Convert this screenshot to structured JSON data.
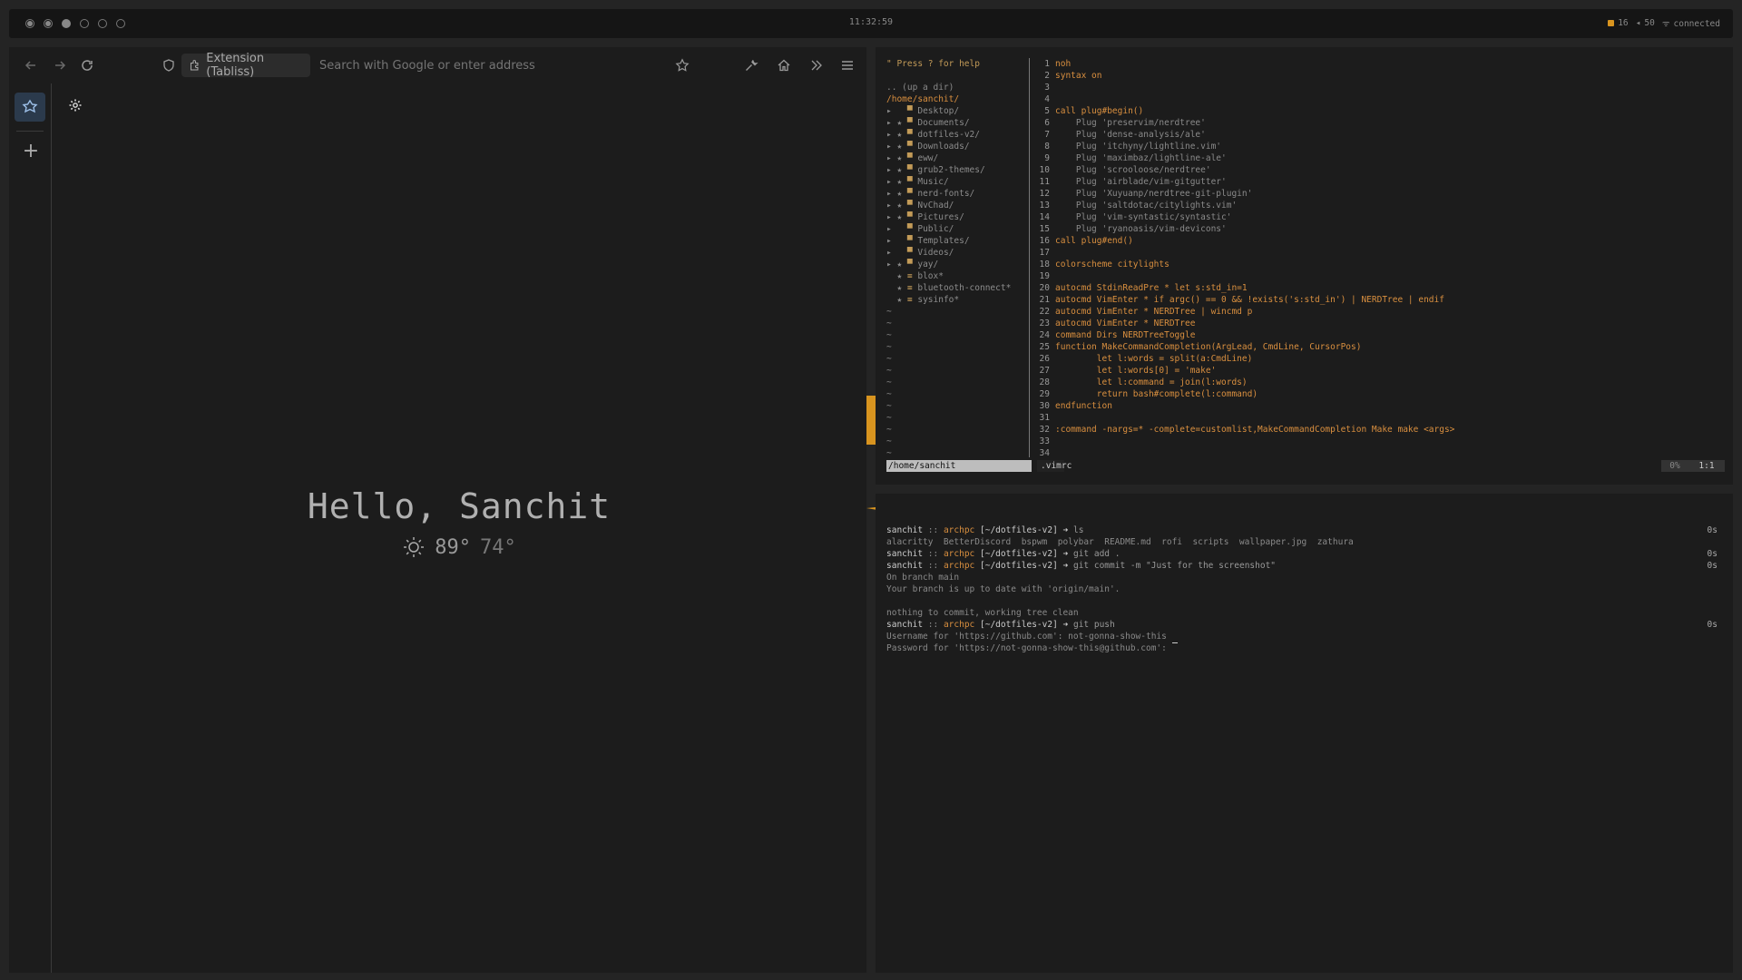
{
  "topbar": {
    "workspaces": [
      "1",
      "2",
      "3",
      "4",
      "5",
      "6"
    ],
    "clock": "11:32:59",
    "updates": "16",
    "volume": "50",
    "network": "connected"
  },
  "browser": {
    "url_pill": "Extension (Tabliss)",
    "url_placeholder": "Search with Google or enter address",
    "greeting": "Hello, Sanchit",
    "temp_high": "89°",
    "temp_low": "74°"
  },
  "vim": {
    "tree_help": "\" Press ? for help",
    "tree_up": ".. (up a dir)",
    "tree_root": "/home/sanchit/",
    "tree_items": [
      {
        "prefix": "▸   ",
        "icon": "▀ ",
        "name": "Desktop/"
      },
      {
        "prefix": "▸ ★ ",
        "icon": "▀ ",
        "name": "Documents/"
      },
      {
        "prefix": "▸ ★ ",
        "icon": "▀ ",
        "name": "dotfiles-v2/"
      },
      {
        "prefix": "▸ ★ ",
        "icon": "▀ ",
        "name": "Downloads/"
      },
      {
        "prefix": "▸ ★ ",
        "icon": "▀ ",
        "name": "eww/"
      },
      {
        "prefix": "▸ ★ ",
        "icon": "▀ ",
        "name": "grub2-themes/"
      },
      {
        "prefix": "▸ ★ ",
        "icon": "▀ ",
        "name": "Music/"
      },
      {
        "prefix": "▸ ★ ",
        "icon": "▀ ",
        "name": "nerd-fonts/"
      },
      {
        "prefix": "▸ ★ ",
        "icon": "▀ ",
        "name": "NvChad/"
      },
      {
        "prefix": "▸ ★ ",
        "icon": "▀ ",
        "name": "Pictures/"
      },
      {
        "prefix": "▸   ",
        "icon": "▀ ",
        "name": "Public/"
      },
      {
        "prefix": "▸   ",
        "icon": "▀ ",
        "name": "Templates/"
      },
      {
        "prefix": "▸   ",
        "icon": "▀ ",
        "name": "Videos/"
      },
      {
        "prefix": "▸ ★ ",
        "icon": "▀ ",
        "name": "yay/"
      },
      {
        "prefix": "  ★ ",
        "icon": "≡ ",
        "name": "blox*"
      },
      {
        "prefix": "  ★ ",
        "icon": "≡ ",
        "name": "bluetooth-connect*"
      },
      {
        "prefix": "  ★ ",
        "icon": "≡ ",
        "name": "sysinfo*"
      }
    ],
    "tildes": 13,
    "code_lines": [
      {
        "n": "1",
        "t": "noh"
      },
      {
        "n": "2",
        "t": "syntax on"
      },
      {
        "n": "3",
        "t": ""
      },
      {
        "n": "4",
        "t": ""
      },
      {
        "n": "5",
        "t": "call plug#begin()"
      },
      {
        "n": "6",
        "t": "    Plug 'preservim/nerdtree'"
      },
      {
        "n": "7",
        "t": "    Plug 'dense-analysis/ale'"
      },
      {
        "n": "8",
        "t": "    Plug 'itchyny/lightline.vim'"
      },
      {
        "n": "9",
        "t": "    Plug 'maximbaz/lightline-ale'"
      },
      {
        "n": "10",
        "t": "    Plug 'scrooloose/nerdtree'"
      },
      {
        "n": "11",
        "t": "    Plug 'airblade/vim-gitgutter'"
      },
      {
        "n": "12",
        "t": "    Plug 'Xuyuanp/nerdtree-git-plugin'"
      },
      {
        "n": "13",
        "t": "    Plug 'saltdotac/citylights.vim'"
      },
      {
        "n": "14",
        "t": "    Plug 'vim-syntastic/syntastic'"
      },
      {
        "n": "15",
        "t": "    Plug 'ryanoasis/vim-devicons'"
      },
      {
        "n": "16",
        "t": "call plug#end()"
      },
      {
        "n": "17",
        "t": ""
      },
      {
        "n": "18",
        "t": "colorscheme citylights"
      },
      {
        "n": "19",
        "t": ""
      },
      {
        "n": "20",
        "t": "autocmd StdinReadPre * let s:std_in=1"
      },
      {
        "n": "21",
        "t": "autocmd VimEnter * if argc() == 0 && !exists('s:std_in') | NERDTree | endif"
      },
      {
        "n": "22",
        "t": "autocmd VimEnter * NERDTree | wincmd p"
      },
      {
        "n": "23",
        "t": "autocmd VimEnter * NERDTree"
      },
      {
        "n": "24",
        "t": "command Dirs NERDTreeToggle"
      },
      {
        "n": "25",
        "t": "function MakeCommandCompletion(ArgLead, CmdLine, CursorPos)"
      },
      {
        "n": "26",
        "t": "        let l:words = split(a:CmdLine)"
      },
      {
        "n": "27",
        "t": "        let l:words[0] = 'make'"
      },
      {
        "n": "28",
        "t": "        let l:command = join(l:words)"
      },
      {
        "n": "29",
        "t": "        return bash#complete(l:command)"
      },
      {
        "n": "30",
        "t": "endfunction"
      },
      {
        "n": "31",
        "t": ""
      },
      {
        "n": "32",
        "t": ":command -nargs=* -complete=customlist,MakeCommandCompletion Make make <args>"
      },
      {
        "n": "33",
        "t": ""
      },
      {
        "n": "34",
        "t": ""
      }
    ],
    "status_left": "/home/sanchit",
    "status_file": ".vimrc",
    "status_pct": "0%",
    "status_pos": "1:1"
  },
  "terminal": {
    "lines": [
      {
        "type": "prompt",
        "user": "sanchit",
        "host": "archpc",
        "dir": "[~/dotfiles-v2]",
        "cmd": "ls",
        "dur": "0s"
      },
      {
        "type": "out",
        "text": "alacritty  BetterDiscord  bspwm  polybar  README.md  rofi  scripts  wallpaper.jpg  zathura"
      },
      {
        "type": "prompt",
        "user": "sanchit",
        "host": "archpc",
        "dir": "[~/dotfiles-v2]",
        "cmd": "git add .",
        "dur": "0s"
      },
      {
        "type": "prompt",
        "user": "sanchit",
        "host": "archpc",
        "dir": "[~/dotfiles-v2]",
        "cmd": "git commit -m \"Just for the screenshot\"",
        "dur": "0s"
      },
      {
        "type": "out",
        "text": "On branch main"
      },
      {
        "type": "out",
        "text": "Your branch is up to date with 'origin/main'."
      },
      {
        "type": "out",
        "text": ""
      },
      {
        "type": "out",
        "text": "nothing to commit, working tree clean"
      },
      {
        "type": "prompt",
        "user": "sanchit",
        "host": "archpc",
        "dir": "[~/dotfiles-v2]",
        "cmd": "git push",
        "dur": "0s"
      },
      {
        "type": "out",
        "text": "Username for 'https://github.com': not-gonna-show-this"
      },
      {
        "type": "out",
        "text": "Password for 'https://not-gonna-show-this@github.com': ",
        "cursor": true
      }
    ]
  },
  "colors": {
    "accent": "#d8941f",
    "background": "#1c1c1c",
    "desktop": "#242424"
  }
}
